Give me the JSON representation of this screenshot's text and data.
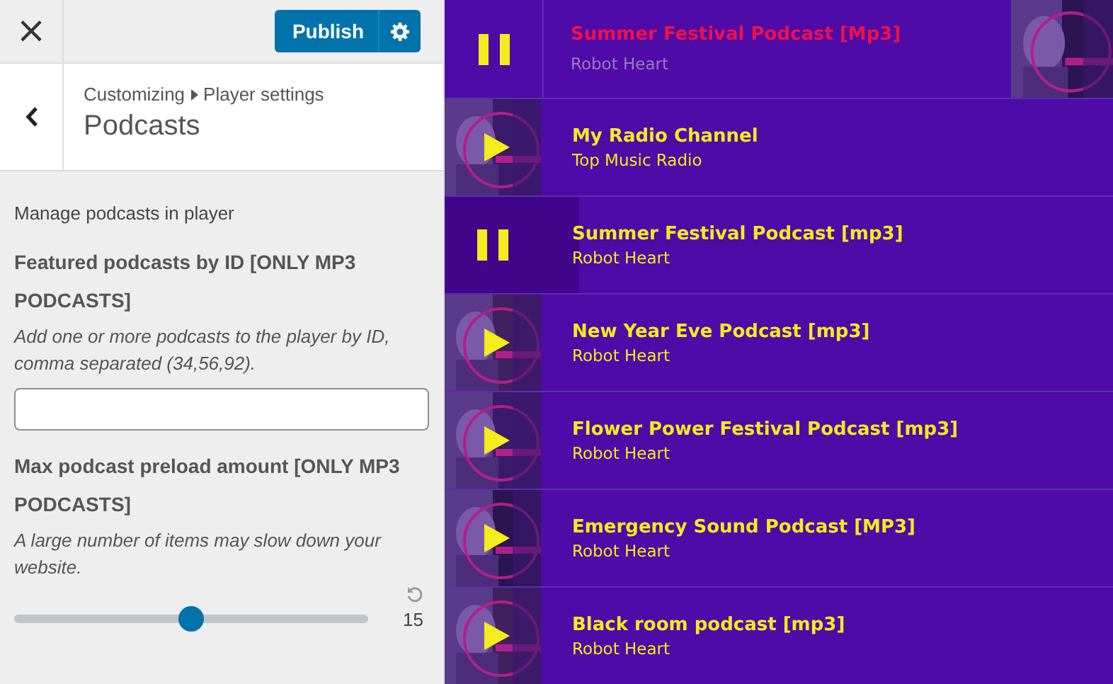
{
  "customizer": {
    "close": "×",
    "publish": "Publish",
    "breadcrumb": [
      "Customizing",
      "Player settings"
    ],
    "section_title": "Podcasts",
    "intro": "Manage podcasts in player",
    "featured": {
      "label": "Featured podcasts by ID [ONLY MP3 PODCASTS]",
      "description": "Add one or more podcasts to the player by ID, comma separated (34,56,92)."
    },
    "preload": {
      "label": "Max podcast preload amount [ONLY MP3 PODCASTS]",
      "description": "A large number of items may slow down your website.",
      "level": 0.5,
      "reading": "15"
    }
  },
  "player": {
    "title": "Summer Festival Podcast [Mp3]",
    "artist": "Robot Heart",
    "playing": true
  },
  "playlist": [
    {
      "title": "My Radio Channel",
      "subtitle": "Top Music Radio",
      "playing": false
    },
    {
      "title": "Summer Festival Podcast [mp3]",
      "subtitle": "Robot Heart",
      "playing": true
    },
    {
      "title": "New Year Eve Podcast [mp3]",
      "subtitle": "Robot Heart",
      "playing": false
    },
    {
      "title": "Flower Power Festival Podcast [mp3]",
      "subtitle": "Robot Heart",
      "playing": false
    },
    {
      "title": "Emergency Sound Podcast [MP3]",
      "subtitle": "Robot Heart",
      "playing": false
    },
    {
      "title": "Black room podcast [mp3]",
      "subtitle": "Robot Heart",
      "playing": false
    }
  ]
}
